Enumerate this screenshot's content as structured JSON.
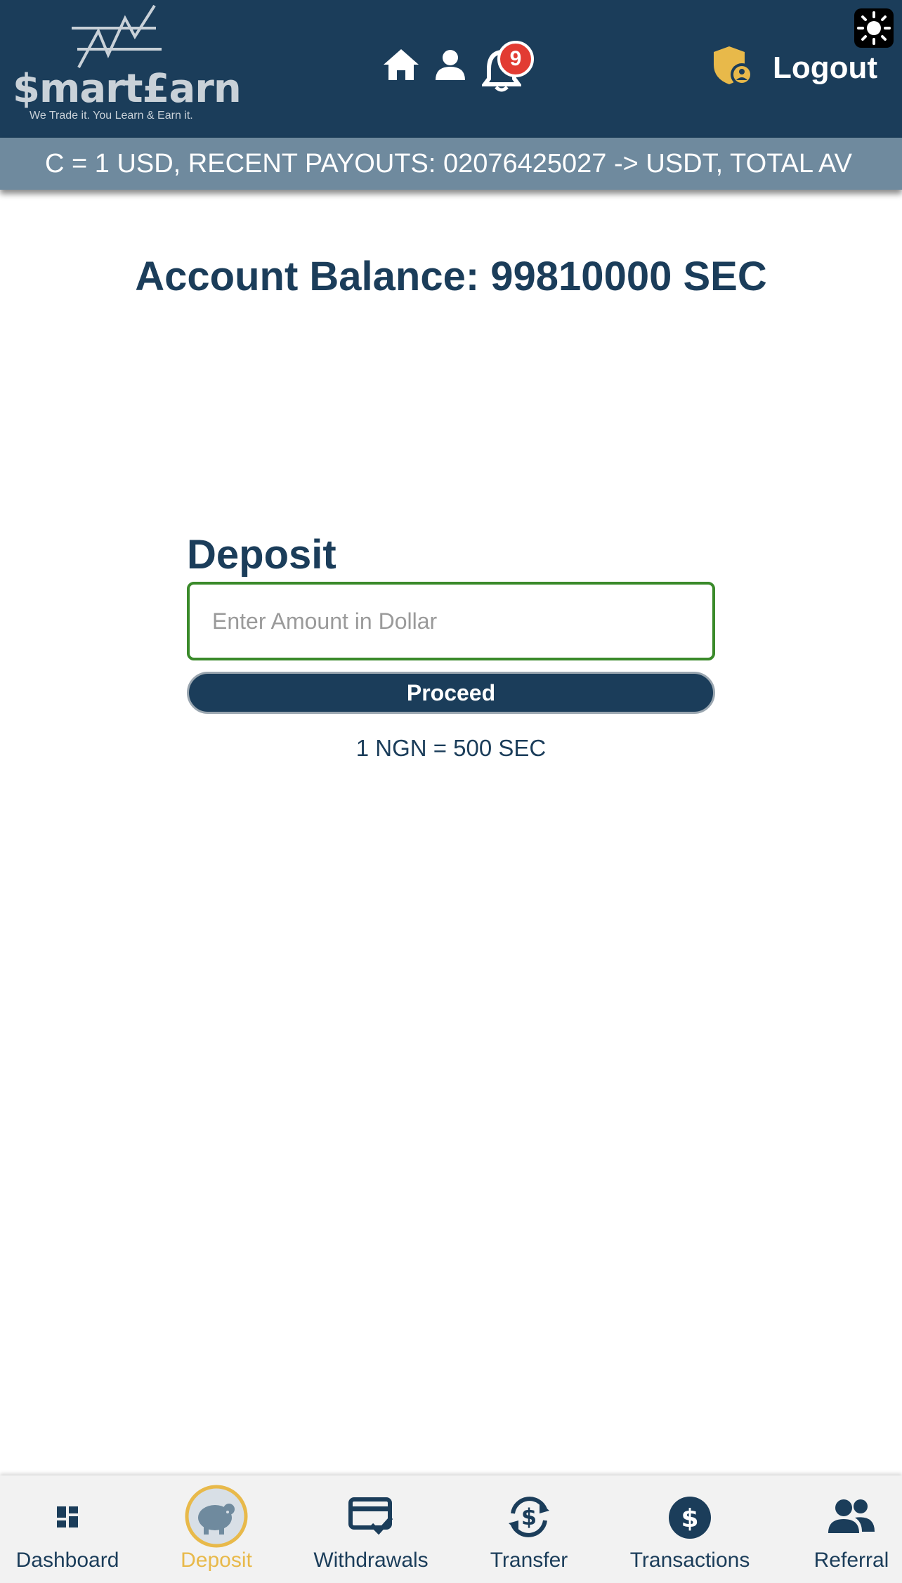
{
  "header": {
    "logo_text": "$mart£arn",
    "logo_tagline": "We Trade it. You Learn & Earn it.",
    "notification_count": "9",
    "logout_label": "Logout"
  },
  "ticker": {
    "text": "C = 1 USD, RECENT PAYOUTS: 02076425027 -> USDT, TOTAL AV"
  },
  "main": {
    "balance": "Account Balance: 99810000 SEC",
    "deposit_title": "Deposit",
    "amount_placeholder": "Enter Amount in Dollar",
    "amount_value": "",
    "proceed_label": "Proceed",
    "rate_text": "1 NGN = 500 SEC"
  },
  "bottom_nav": {
    "items": [
      {
        "label": "Dashboard",
        "icon": "dashboard-icon"
      },
      {
        "label": "Deposit",
        "icon": "piggy-bank-icon",
        "active": true
      },
      {
        "label": "Withdrawals",
        "icon": "card-check-icon"
      },
      {
        "label": "Transfer",
        "icon": "exchange-dollar-icon"
      },
      {
        "label": "Transactions",
        "icon": "dollar-circle-icon"
      },
      {
        "label": "Referral",
        "icon": "users-icon"
      }
    ]
  },
  "colors": {
    "primary": "#1b3d5a",
    "accent": "#e8b94a",
    "ticker_bg": "#6f8a9e",
    "input_border": "#3a8a2a",
    "badge": "#e23b32"
  }
}
